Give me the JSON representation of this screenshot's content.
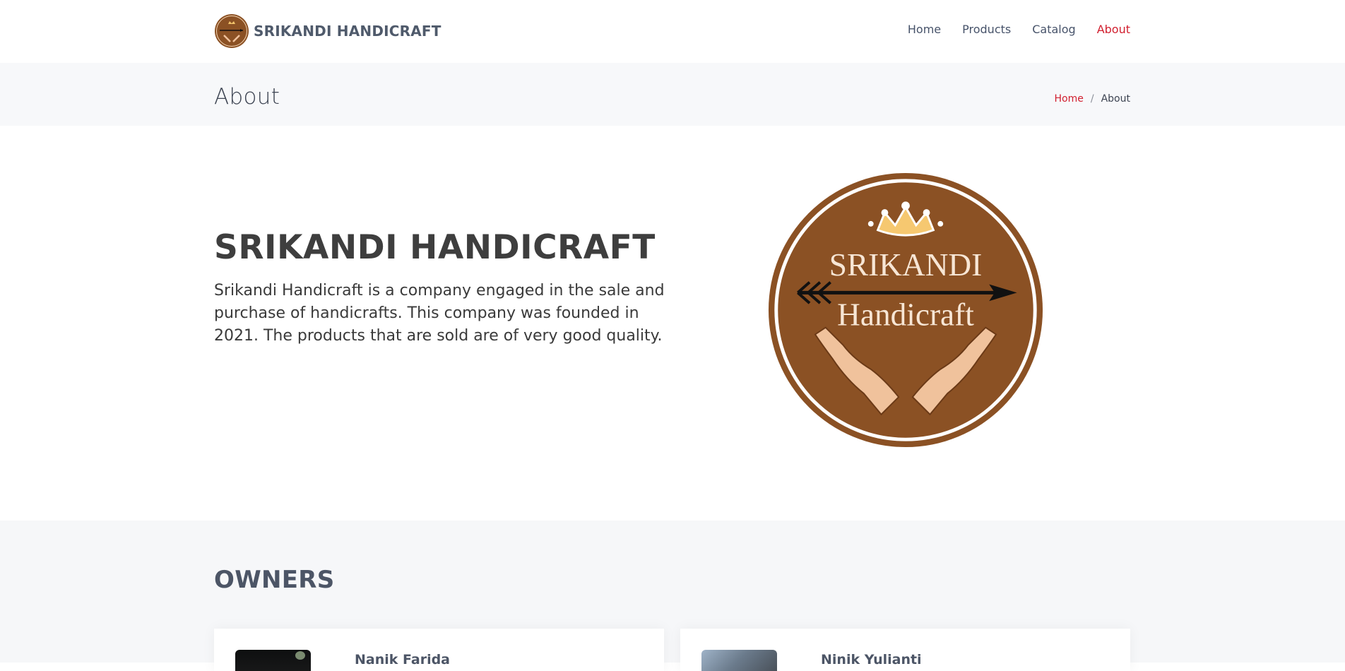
{
  "header": {
    "brand_name": "SRIKANDI HANDICRAFT",
    "nav": [
      {
        "label": "Home"
      },
      {
        "label": "Products"
      },
      {
        "label": "Catalog"
      },
      {
        "label": "About",
        "active": true
      }
    ]
  },
  "breadcrumb": {
    "title": "About",
    "home_label": "Home",
    "separator": "/",
    "current_label": "About"
  },
  "about": {
    "heading": "SRIKANDI HANDICRAFT",
    "description": "Srikandi Handicraft is a company engaged in the sale and purchase of handicrafts. This company was founded in 2021. The products that are sold are of very good quality.",
    "logo_text_line1": "SRIKANDI",
    "logo_text_line2": "Handicraft"
  },
  "owners": {
    "title": "OWNERS",
    "cards": [
      {
        "name": "Nanik Farida"
      },
      {
        "name": "Ninik Yulianti"
      }
    ]
  },
  "colors": {
    "accent": "#d11f2f",
    "logo_brown": "#8b5124",
    "band_bg": "#f7f8fa",
    "text_dark": "#3e3e3e"
  }
}
